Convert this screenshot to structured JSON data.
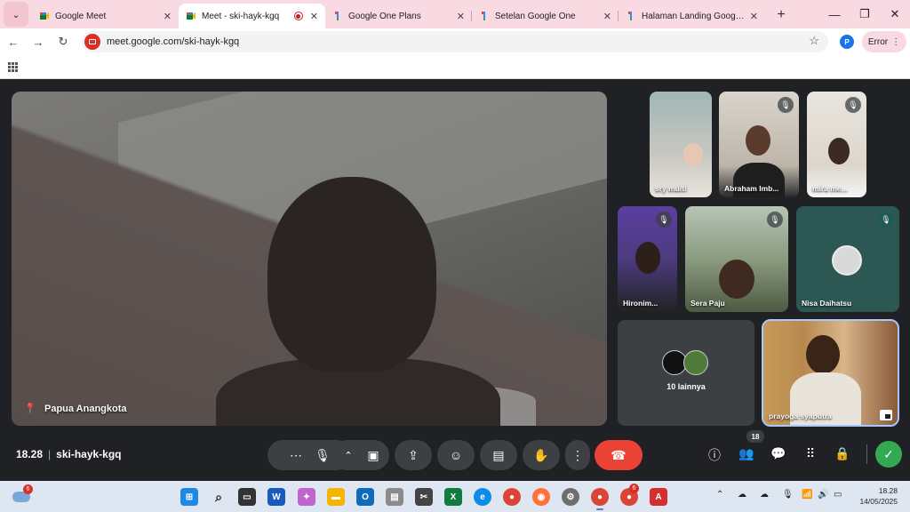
{
  "browser": {
    "tabs": [
      {
        "title": "Google Meet",
        "active": false
      },
      {
        "title": "Meet - ski-hayk-kgq",
        "active": true
      },
      {
        "title": "Google One Plans",
        "active": false
      },
      {
        "title": "Setelan Google One",
        "active": false
      },
      {
        "title": "Halaman Landing Google One",
        "active": false
      }
    ],
    "url": "meet.google.com/ski-hayk-kgq",
    "profile_initial": "P",
    "error_label": "Error"
  },
  "meet": {
    "main_tile": {
      "name": "Papua Anangkota"
    },
    "participants": [
      {
        "name": "sry multi",
        "muted": false
      },
      {
        "name": "Abraham Imb...",
        "muted": true
      },
      {
        "name": "mira me...",
        "muted": true
      },
      {
        "name": "Hironim...",
        "muted": true
      },
      {
        "name": "Sera Paju",
        "muted": true
      },
      {
        "name": "Nisa Daihatsu",
        "muted": true
      },
      {
        "name": "prayoga syaputra",
        "muted": false
      }
    ],
    "more_label": "10 lainnya",
    "time": "18.28",
    "meeting_code": "ski-hayk-kgq",
    "people_count": "18"
  },
  "taskbar": {
    "weather_badge": "6",
    "edge_badge": "6",
    "time": "18.28",
    "date": "14/05/2025"
  },
  "colors": {
    "hangup": "#ea4335",
    "tab_strip": "#f9d9e2",
    "meet_bg": "#202124",
    "control_bg": "#3c4043",
    "companion": "#34a853"
  }
}
